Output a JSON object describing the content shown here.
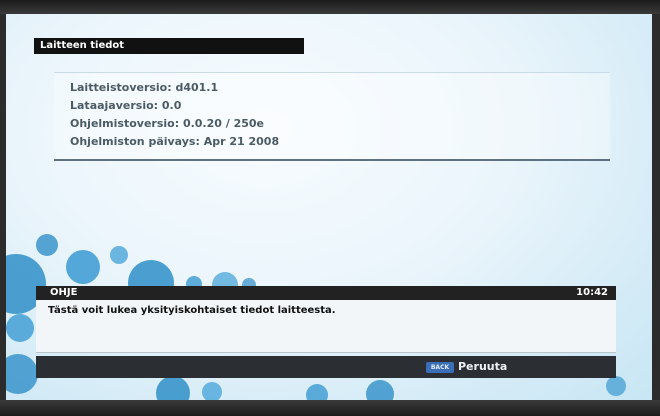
{
  "device_info": {
    "title": "Laitteen tiedot",
    "lines": [
      "Laitteistoversio: d401.1",
      "Lataajaversio: 0.0",
      "Ohjelmistoversio: 0.0.20 / 250e",
      "Ohjelmiston päivays: Apr 21 2008"
    ]
  },
  "help": {
    "label": "OHJE",
    "time": "10:42",
    "text": "Tästä voit lukea yksityiskohtaiset tiedot laitteesta."
  },
  "footer": {
    "back_key": "BACK",
    "cancel_label": "Peruuta"
  },
  "colors": {
    "screen_bg": "#eaf5fb",
    "title_bar": "#111111",
    "bubble_blue": "#2f8fc8",
    "back_key": "#3a6fb8"
  }
}
